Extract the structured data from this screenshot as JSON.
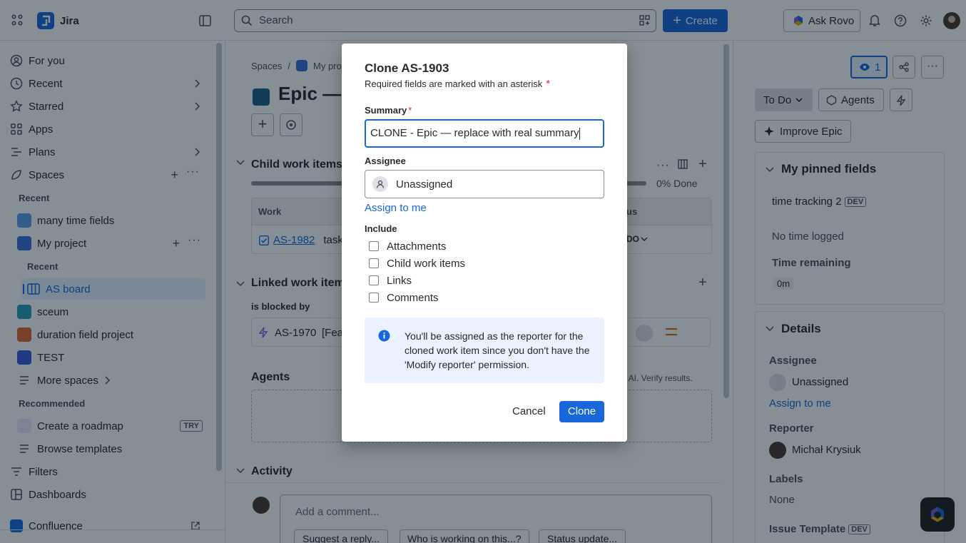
{
  "topbar": {
    "app_name": "Jira",
    "search_placeholder": "Search",
    "create_label": "Create",
    "rovo_label": "Ask Rovo"
  },
  "sidebar": {
    "items": [
      {
        "label": "For you"
      },
      {
        "label": "Recent"
      },
      {
        "label": "Starred"
      },
      {
        "label": "Apps"
      },
      {
        "label": "Plans"
      },
      {
        "label": "Spaces"
      }
    ],
    "recent_heading": "Recent",
    "projects": [
      {
        "label": "many time fields",
        "color": "#5e9ee8"
      },
      {
        "label": "My project",
        "color": "#3d6fd9"
      }
    ],
    "project_recent_heading": "Recent",
    "board_label": "AS board",
    "projects2": [
      {
        "label": "sceum",
        "color": "#2a9fb8"
      },
      {
        "label": "duration field project",
        "color": "#e0682c"
      },
      {
        "label": "TEST",
        "color": "#3d5bd9"
      }
    ],
    "more_spaces": "More spaces",
    "recommended_heading": "Recommended",
    "roadmap_label": "Create a roadmap",
    "try_badge": "TRY",
    "templates_label": "Browse templates",
    "filters_label": "Filters",
    "dashboards_label": "Dashboards",
    "confluence_label": "Confluence"
  },
  "main": {
    "breadcrumb_spaces": "Spaces",
    "breadcrumb_sep": "/",
    "breadcrumb_project": "My proj",
    "title": "Epic — r",
    "child_heading": "Child work items",
    "progress_text": "0% Done",
    "col_work": "Work",
    "col_status": "us",
    "child_key": "AS-1982",
    "child_summary": "task",
    "child_status": "DO",
    "linked_heading": "Linked work item",
    "blocked_by": "is blocked by",
    "linked_key": "AS-1970",
    "linked_summary": "[Fea",
    "agents_heading": "Agents",
    "ai_note": "s AI. Verify results.",
    "activity_heading": "Activity",
    "comment_placeholder": "Add a comment...",
    "suggestions": [
      "Suggest a reply...",
      "Who is working on this...?",
      "Status update..."
    ]
  },
  "right": {
    "watch_count": "1",
    "status_label": "To Do",
    "agents_label": "Agents",
    "improve_label": "Improve Epic",
    "pinned_heading": "My pinned fields",
    "time_tracking_label": "time tracking 2",
    "dev_badge": "DEV",
    "no_time": "No time logged",
    "time_remaining_label": "Time remaining",
    "time_remaining_value": "0m",
    "details_heading": "Details",
    "assignee_label": "Assignee",
    "assignee_value": "Unassigned",
    "assign_to_me": "Assign to me",
    "reporter_label": "Reporter",
    "reporter_value": "Michał Krysiuk",
    "labels_label": "Labels",
    "labels_value": "None",
    "issue_template_label": "Issue Template",
    "issue_template_badge": "DEV"
  },
  "modal": {
    "title": "Clone AS-1903",
    "required_note": "Required fields are marked with an asterisk",
    "asterisk": "*",
    "summary_label": "Summary",
    "summary_value": "CLONE - Epic — replace with real summary",
    "assignee_label": "Assignee",
    "assignee_value": "Unassigned",
    "assign_to_me": "Assign to me",
    "include_label": "Include",
    "options": [
      "Attachments",
      "Child work items",
      "Links",
      "Comments"
    ],
    "info_text": "You'll be assigned as the reporter for the cloned work item since you don't have the 'Modify reporter' permission.",
    "cancel_label": "Cancel",
    "clone_label": "Clone"
  }
}
